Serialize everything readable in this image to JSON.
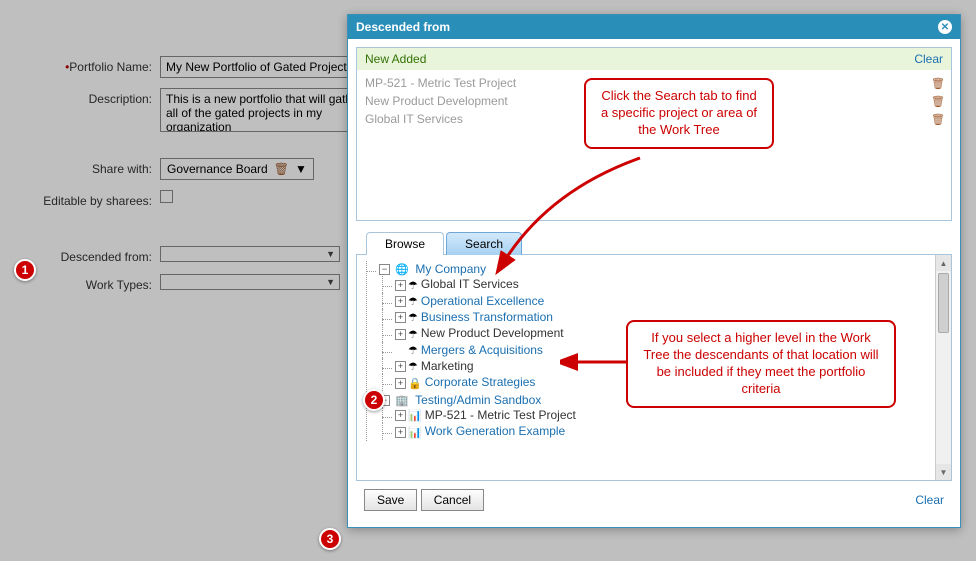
{
  "form": {
    "portfolio_name_label": "Portfolio Name:",
    "portfolio_name_value": "My New Portfolio of Gated Projects",
    "description_label": "Description:",
    "description_value": "This is a new portfolio that will gather all of the gated projects in my organization",
    "share_with_label": "Share with:",
    "share_with_value": "Governance Board",
    "editable_label": "Editable by sharees:",
    "descended_label": "Descended from:",
    "descended_value": "",
    "work_types_label": "Work Types:",
    "work_types_value": ""
  },
  "dialog": {
    "title": "Descended from",
    "new_added_header": "New Added",
    "clear_label": "Clear",
    "added_items": [
      "MP-521 - Metric Test Project",
      "New Product Development",
      "Global IT Services"
    ],
    "tabs": {
      "browse": "Browse",
      "search": "Search"
    },
    "tree": {
      "root": "My Company",
      "children": [
        "Global IT Services",
        "Operational Excellence",
        "Business Transformation",
        "New Product Development",
        "Mergers & Acquisitions",
        "Marketing",
        "Corporate Strategies"
      ],
      "root2": "Testing/Admin Sandbox",
      "children2": [
        "MP-521 - Metric Test Project",
        "Work Generation Example"
      ]
    },
    "save": "Save",
    "cancel": "Cancel",
    "footer_clear": "Clear"
  },
  "steps": {
    "s1": "1",
    "s2": "2",
    "s3": "3"
  },
  "callouts": {
    "c1": "Click the Search tab to find a specific project or area of the Work Tree",
    "c2": "If you select a higher level in the Work Tree the descendants of that location will be included if they meet the portfolio criteria"
  }
}
